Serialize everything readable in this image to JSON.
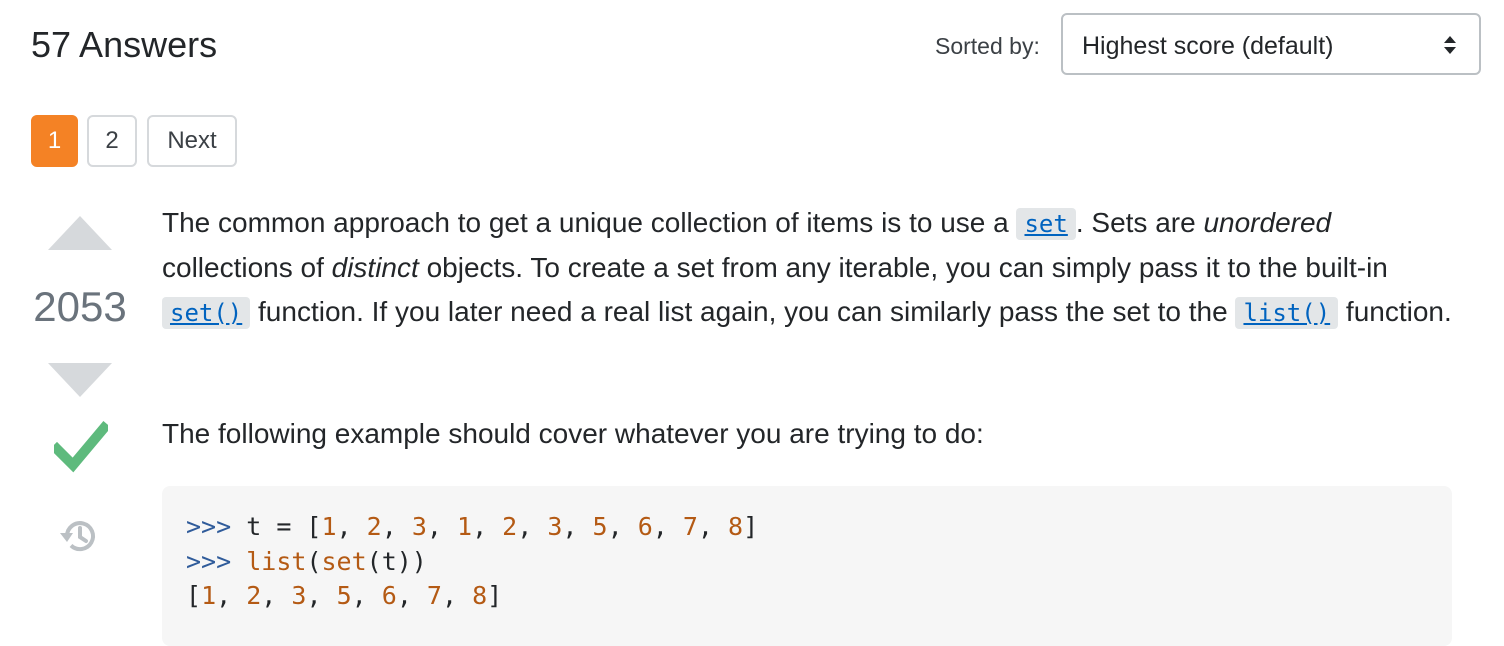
{
  "header": {
    "answers_count": "57 Answers",
    "sort_label": "Sorted by:",
    "sort_value": "Highest score (default)"
  },
  "pagination": {
    "pages": [
      "1",
      "2"
    ],
    "next": "Next",
    "current": "1"
  },
  "answer": {
    "score": "2053",
    "accepted": true,
    "paragraph1": {
      "t1": "The common approach to get a unique collection of items is to use a ",
      "code1": "set",
      "t2": ". Sets are ",
      "em1": "unordered",
      "t3": " collections of ",
      "em2": "distinct",
      "t4": " objects. To create a set from any iterable, you can simply pass it to the built-in ",
      "code2": "set()",
      "t5": " function. If you later need a real list again, you can similarly pass the set to the ",
      "code3": "list()",
      "t6": " function."
    },
    "paragraph2": "The following example should cover whatever you are trying to do:",
    "code_lines": [
      {
        "prompt": ">>> ",
        "text": "t = [1, 2, 3, 1, 2, 3, 5, 6, 7, 8]"
      },
      {
        "prompt": ">>> ",
        "text": "list(set(t))"
      },
      {
        "prompt": "",
        "text": "[1, 2, 3, 5, 6, 7, 8]"
      }
    ]
  },
  "icons": [
    "vote-up-icon",
    "vote-down-icon",
    "accepted-check-icon",
    "history-icon",
    "sort-arrows-icon"
  ],
  "colors": {
    "accent": "#f48225",
    "accepted": "#5eba7d",
    "link": "#0063bf",
    "vote_arrow": "#d6d9dc"
  }
}
